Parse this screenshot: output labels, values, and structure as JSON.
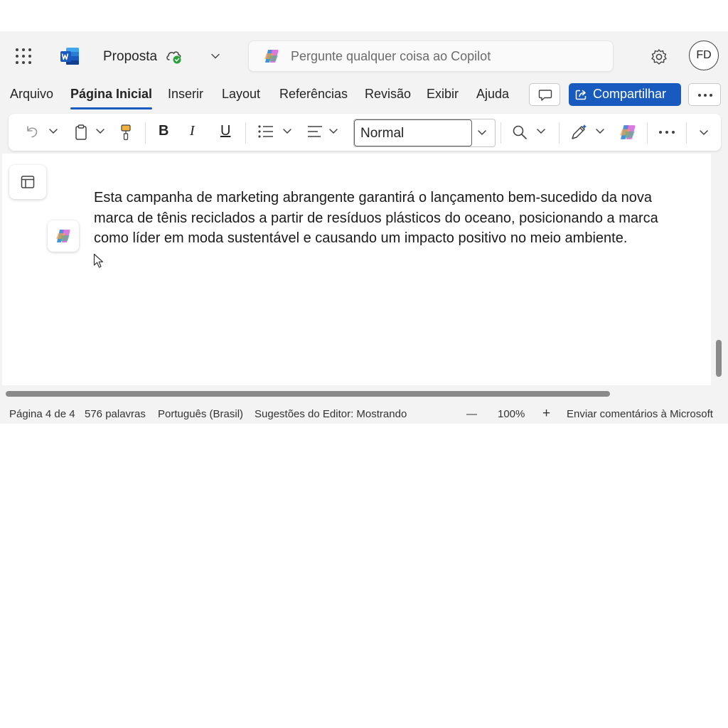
{
  "titlebar": {
    "app_icon": "word-icon",
    "document_title": "Proposta",
    "sync_status_icon": "cloud-check-icon",
    "search_placeholder": "Pergunte qualquer coisa ao Copilot",
    "user_initials": "FD"
  },
  "tabs": [
    {
      "label": "Arquivo",
      "active": false
    },
    {
      "label": "Página Inicial",
      "active": true
    },
    {
      "label": "Inserir",
      "active": false
    },
    {
      "label": "Layout",
      "active": false
    },
    {
      "label": "Referências",
      "active": false
    },
    {
      "label": "Revisão",
      "active": false
    },
    {
      "label": "Exibir",
      "active": false
    },
    {
      "label": "Ajuda",
      "active": false
    }
  ],
  "actions": {
    "share_label": "Compartilhar"
  },
  "ribbon": {
    "bold_label": "B",
    "italic_label": "I",
    "underline_label": "U",
    "style_value": "Normal"
  },
  "document": {
    "paragraph": "Esta campanha de marketing abrangente garantirá o lançamento bem-sucedido da nova marca de tênis reciclados a partir de resíduos plásticos do oceano, posicionando a marca como líder em moda sustentável e causando um impacto positivo no meio ambiente."
  },
  "status": {
    "page": "Página 4 de 4",
    "words": "576 palavras",
    "language": "Português (Brasil)",
    "editor": "Sugestões do Editor: Mostrando",
    "zoom_out": "—",
    "zoom": "100%",
    "zoom_in": "+",
    "feedback": "Enviar comentários à Microsoft"
  },
  "colors": {
    "accent": "#185abd",
    "chrome_bg": "#f3f3f3",
    "success": "#2aa13a"
  }
}
